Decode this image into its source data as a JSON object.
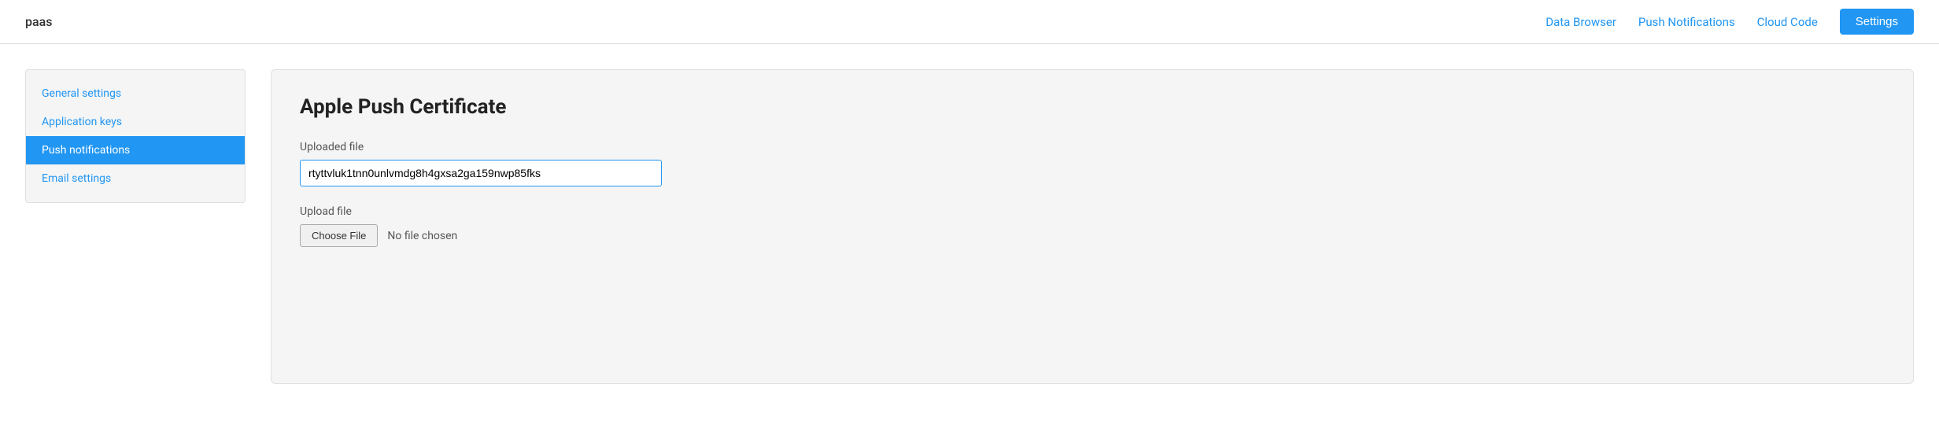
{
  "topbar": {
    "brand": "paas",
    "nav": {
      "data_browser": "Data Browser",
      "push_notifications": "Push Notifications",
      "cloud_code": "Cloud Code",
      "settings": "Settings"
    }
  },
  "sidebar": {
    "items": [
      {
        "id": "general-settings",
        "label": "General settings",
        "active": false
      },
      {
        "id": "application-keys",
        "label": "Application keys",
        "active": false
      },
      {
        "id": "push-notifications",
        "label": "Push notifications",
        "active": true
      },
      {
        "id": "email-settings",
        "label": "Email settings",
        "active": false
      }
    ]
  },
  "content": {
    "card": {
      "title": "Apple Push Certificate",
      "uploaded_file_label": "Uploaded file",
      "uploaded_file_value": "rtyttvluk1tnn0unlvmdg8h4gxsa2ga159nwp85fks",
      "upload_file_label": "Upload file",
      "choose_file_button": "Choose File",
      "no_file_text": "No file chosen"
    }
  }
}
